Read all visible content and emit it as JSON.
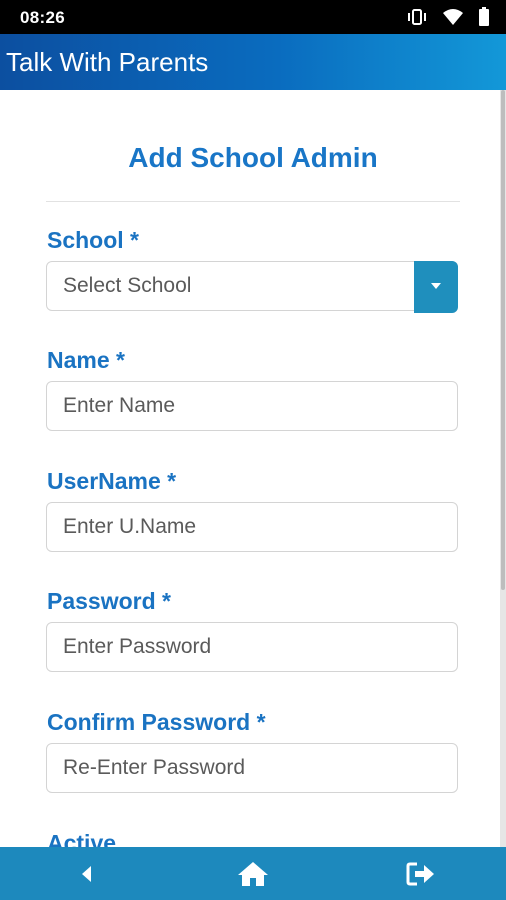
{
  "status_bar": {
    "time": "08:26",
    "icons": [
      "vibrate-icon",
      "wifi-icon",
      "battery-icon"
    ]
  },
  "app_bar": {
    "title": "Talk With Parents",
    "colors": {
      "start": "#0c4fa0",
      "end": "#1398d8"
    }
  },
  "form": {
    "title": "Add School Admin",
    "fields": [
      {
        "label": "School *",
        "placeholder": "Select School",
        "type": "select"
      },
      {
        "label": "Name *",
        "placeholder": "Enter Name",
        "type": "text"
      },
      {
        "label": "UserName *",
        "placeholder": "Enter U.Name",
        "type": "text"
      },
      {
        "label": "Password *",
        "placeholder": "Enter Password",
        "type": "password"
      },
      {
        "label": "Confirm Password *",
        "placeholder": "Re-Enter Password",
        "type": "password"
      }
    ],
    "next_label": "Active"
  },
  "bottom_nav": {
    "items": [
      "back-icon",
      "home-icon",
      "logout-icon"
    ],
    "color": "#1d89bd"
  }
}
